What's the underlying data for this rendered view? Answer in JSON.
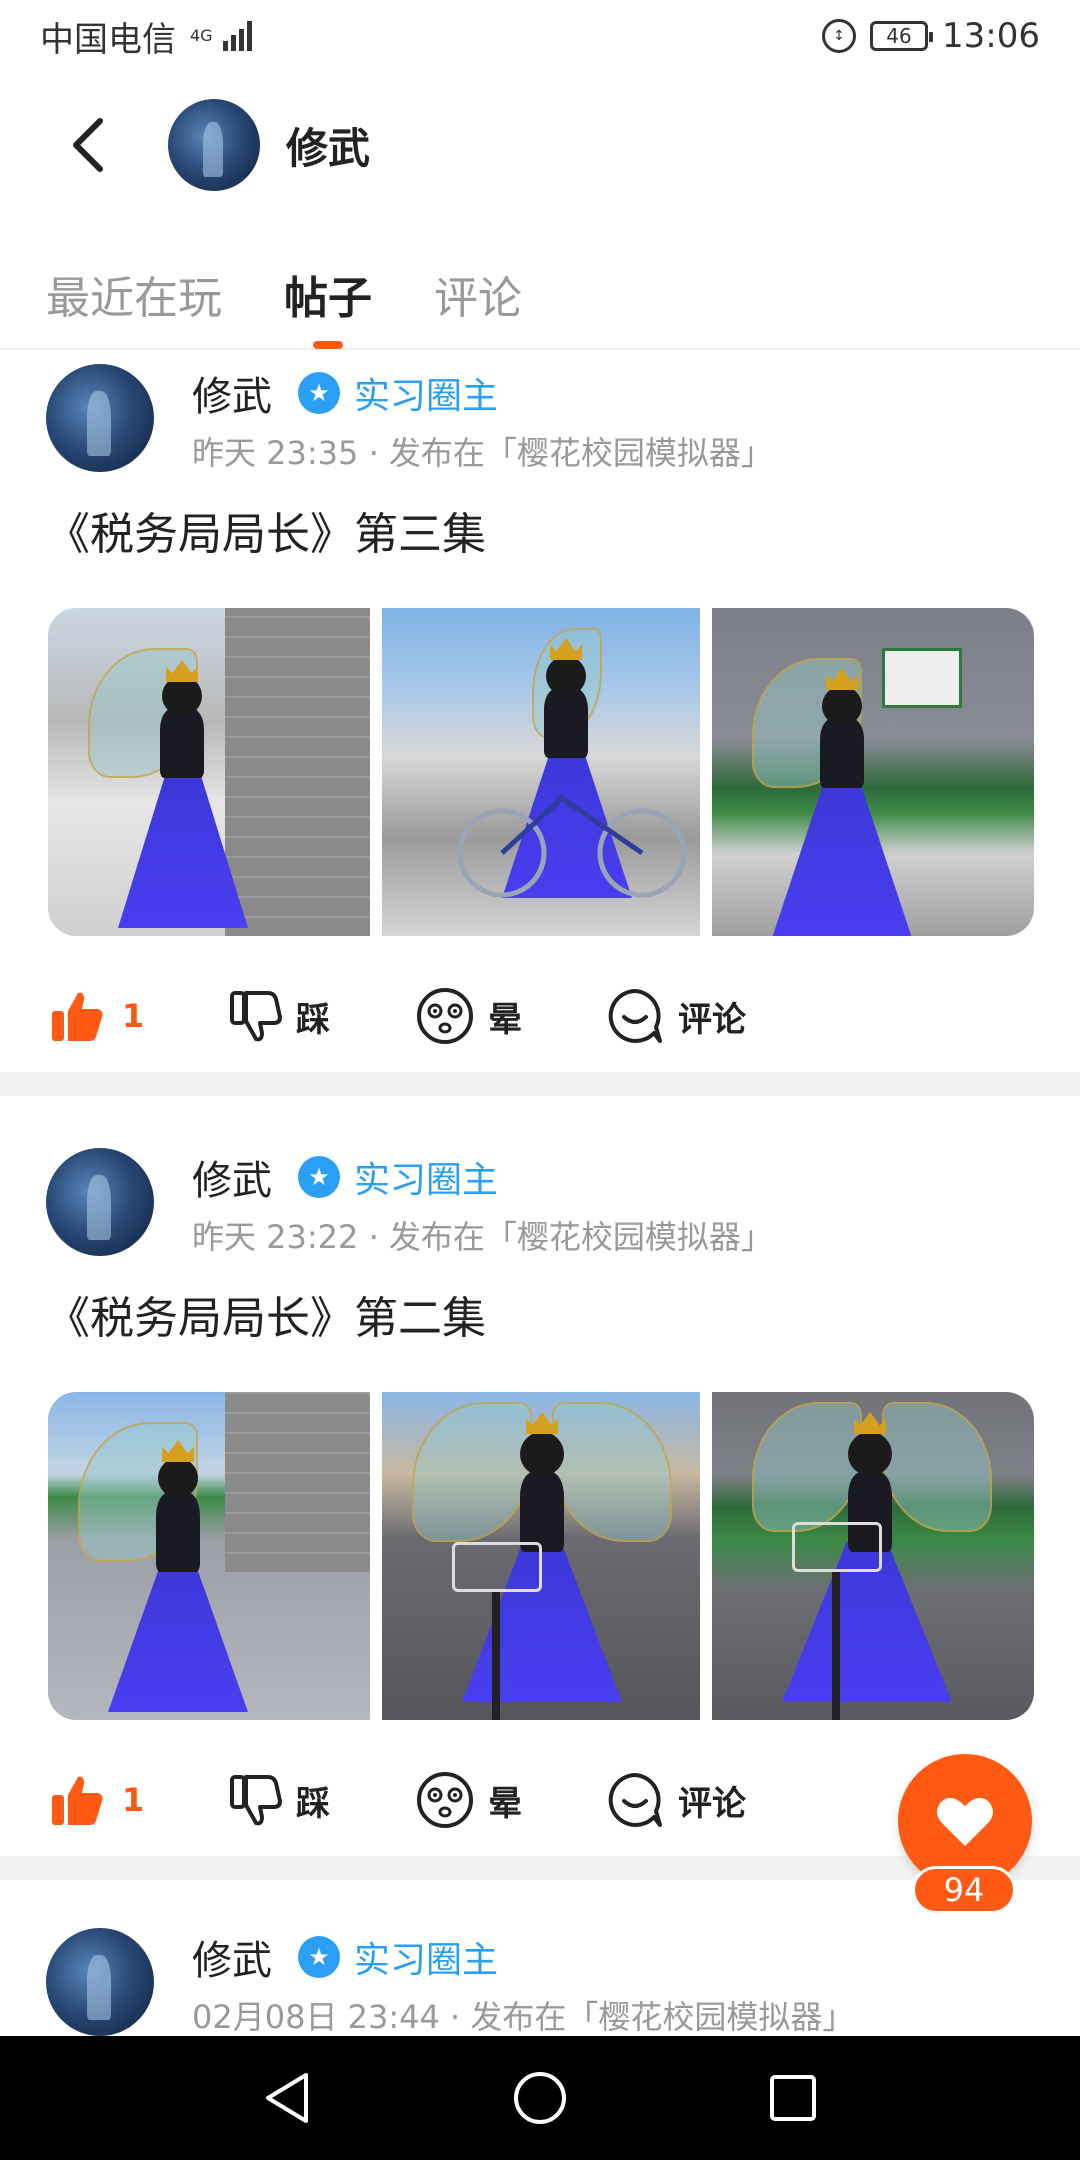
{
  "status_bar": {
    "carrier": "中国电信",
    "network": "4G",
    "battery": "46",
    "time": "13:06"
  },
  "header": {
    "title": "修武",
    "back_icon": "chevron-left-icon"
  },
  "tabs": [
    {
      "label": "最近在玩",
      "active": false
    },
    {
      "label": "帖子",
      "active": true
    },
    {
      "label": "评论",
      "active": false
    }
  ],
  "posts": [
    {
      "author": "修武",
      "badge": "实习圈主",
      "meta": "昨天 23:35 · 发布在「樱花校园模拟器」",
      "title": "《税务局局长》第三集",
      "like_count": "1",
      "dislike_label": "踩",
      "dizzy_label": "晕",
      "comment_label": "评论"
    },
    {
      "author": "修武",
      "badge": "实习圈主",
      "meta": "昨天 23:22 · 发布在「樱花校园模拟器」",
      "title": "《税务局局长》第二集",
      "like_count": "1",
      "dislike_label": "踩",
      "dizzy_label": "晕",
      "comment_label": "评论"
    },
    {
      "author": "修武",
      "badge": "实习圈主",
      "meta": "02月08日 23:44 · 发布在「樱花校园模拟器」"
    }
  ],
  "fab": {
    "icon": "heart-icon",
    "count": "94"
  },
  "colors": {
    "accent": "#ff5a14",
    "badge": "#2a9ff5",
    "muted": "#999999"
  }
}
